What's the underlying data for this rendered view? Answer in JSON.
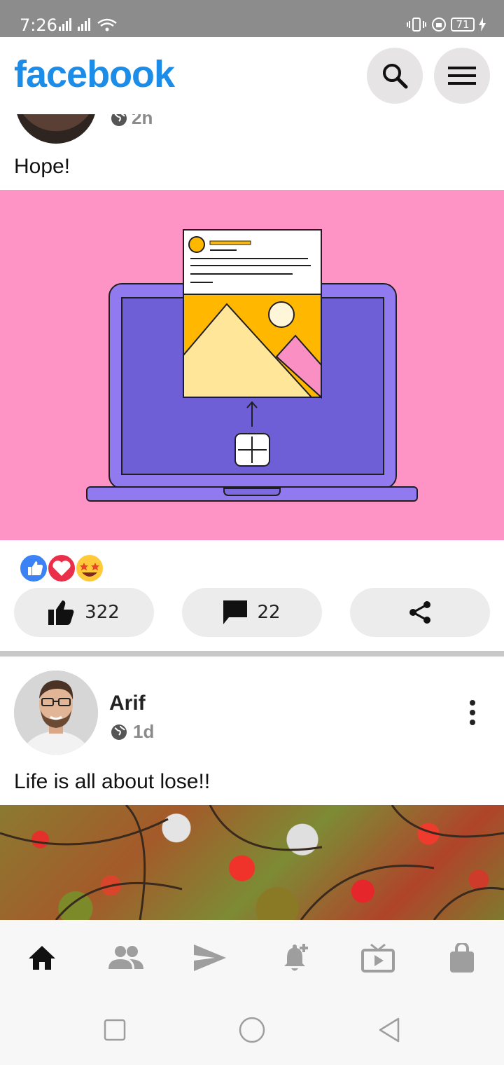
{
  "status_bar": {
    "time": "7:26",
    "battery": "71"
  },
  "header": {
    "logo": "facebook",
    "search_icon": "search-icon",
    "menu_icon": "menu-icon"
  },
  "posts": [
    {
      "visibility_icon": "globe-icon",
      "time": "2h",
      "text": "Hope!",
      "reactions": [
        "like",
        "love",
        "star-struck"
      ],
      "like_count": "322",
      "comment_count": "22"
    },
    {
      "author": "Arif",
      "visibility_icon": "globe-icon",
      "time": "1d",
      "text": "Life is all about lose!!"
    }
  ],
  "bottom_nav": {
    "items": [
      {
        "name": "home",
        "icon": "home-icon",
        "active": true
      },
      {
        "name": "friends",
        "icon": "friends-icon",
        "active": false
      },
      {
        "name": "messages",
        "icon": "send-icon",
        "active": false
      },
      {
        "name": "notifications",
        "icon": "bell-plus-icon",
        "active": false
      },
      {
        "name": "watch",
        "icon": "tv-icon",
        "active": false
      },
      {
        "name": "marketplace",
        "icon": "shopping-bag-icon",
        "active": false
      }
    ]
  },
  "colors": {
    "brand": "#1b8de8",
    "status_bar": "#8c8c8c",
    "post_bg": "#fd94c5",
    "nav_active": "#111111",
    "nav_inactive": "#9e9e9e"
  }
}
